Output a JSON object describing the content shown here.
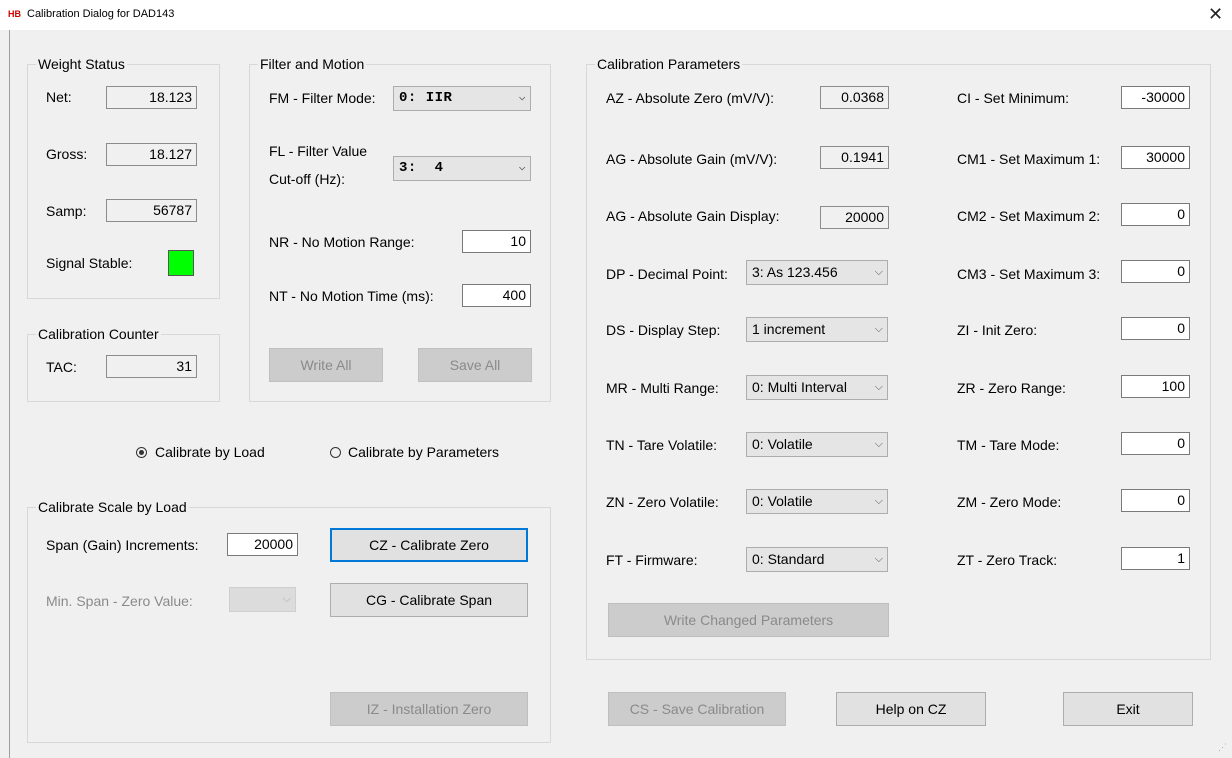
{
  "window": {
    "logo": "HB",
    "title": "Calibration Dialog for DAD143",
    "close_glyph": "✕"
  },
  "weight_status": {
    "legend": "Weight Status",
    "net_label": "Net:",
    "net_value": "18.123",
    "gross_label": "Gross:",
    "gross_value": "18.127",
    "samp_label": "Samp:",
    "samp_value": "56787",
    "stable_label": "Signal Stable:",
    "stable_color": "#00ff00"
  },
  "calibration_counter": {
    "legend": "Calibration Counter",
    "tac_label": "TAC:",
    "tac_value": "31"
  },
  "filter_motion": {
    "legend": "Filter and Motion",
    "fm_label": "FM - Filter Mode:",
    "fm_value": "0: IIR",
    "fl_label_1": "FL - Filter Value",
    "fl_label_2": "Cut-off (Hz):",
    "fl_value": "3:  4",
    "nr_label": "NR - No Motion Range:",
    "nr_value": "10",
    "nt_label": "NT - No Motion Time (ms):",
    "nt_value": "400",
    "write_all": "Write All",
    "save_all": "Save All"
  },
  "mode": {
    "by_load": "Calibrate by Load",
    "by_params": "Calibrate by Parameters",
    "selected": "by_load"
  },
  "scale_by_load": {
    "legend": "Calibrate Scale by Load",
    "span_label": "Span (Gain) Increments:",
    "span_value": "20000",
    "cz_button": "CZ - Calibrate Zero",
    "min_span_label": "Min. Span - Zero Value:",
    "cg_button": "CG - Calibrate Span",
    "iz_button": "IZ - Installation Zero"
  },
  "calibration_parameters": {
    "legend": "Calibration Parameters",
    "az_label": "AZ - Absolute Zero (mV/V):",
    "az_value": "0.0368",
    "ag_label": "AG - Absolute Gain (mV/V):",
    "ag_value": "0.1941",
    "agd_label": "AG - Absolute Gain Display:",
    "agd_value": "20000",
    "dp_label": "DP - Decimal Point:",
    "dp_value": "3: As 123.456",
    "ds_label": "DS - Display Step:",
    "ds_value": "1 increment",
    "mr_label": "MR - Multi Range:",
    "mr_value": "0: Multi Interval",
    "tn_label": "TN - Tare Volatile:",
    "tn_value": "0: Volatile",
    "zn_label": "ZN - Zero Volatile:",
    "zn_value": "0: Volatile",
    "ft_label": "FT - Firmware:",
    "ft_value": "0: Standard",
    "ci_label": "CI - Set Minimum:",
    "ci_value": "-30000",
    "cm1_label": "CM1 - Set Maximum 1:",
    "cm1_value": "30000",
    "cm2_label": "CM2 - Set Maximum 2:",
    "cm2_value": "0",
    "cm3_label": "CM3 - Set Maximum 3:",
    "cm3_value": "0",
    "zi_label": "ZI - Init Zero:",
    "zi_value": "0",
    "zr_label": "ZR - Zero Range:",
    "zr_value": "100",
    "tm_label": "TM - Tare Mode:",
    "tm_value": "0",
    "zm_label": "ZM - Zero Mode:",
    "zm_value": "0",
    "zt_label": "ZT - Zero Track:",
    "zt_value": "1",
    "write_changed": "Write Changed Parameters"
  },
  "footer": {
    "cs_button": "CS - Save Calibration",
    "help_button": "Help on CZ",
    "exit_button": "Exit"
  },
  "icons": {
    "dropdown": "chevron-down-icon",
    "grip": "resize-grip-icon"
  }
}
